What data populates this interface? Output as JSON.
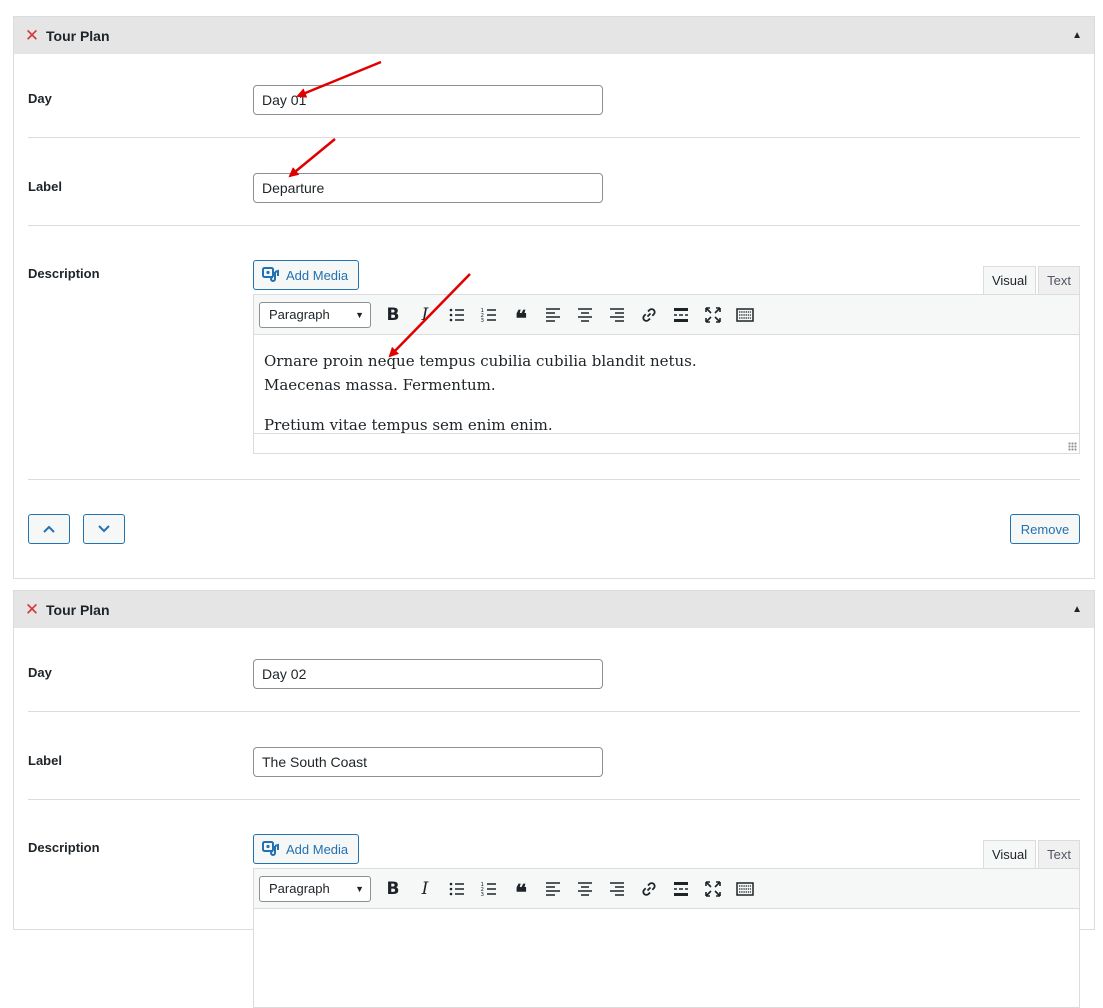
{
  "groups": [
    {
      "title": "Tour Plan",
      "day_label": "Day",
      "day_value": "Day 01",
      "label_label": "Label",
      "label_value": "Departure",
      "description_label": "Description",
      "add_media_label": "Add Media",
      "tabs": [
        "Visual",
        "Text"
      ],
      "format_value": "Paragraph",
      "content": [
        "Ornare proin neque tempus cubilia cubilia blandit netus.",
        "Maecenas massa. Fermentum.",
        "Pretium vitae tempus sem enim enim."
      ],
      "remove_label": "Remove"
    },
    {
      "title": "Tour Plan",
      "day_label": "Day",
      "day_value": "Day 02",
      "label_label": "Label",
      "label_value": "The South Coast",
      "description_label": "Description",
      "add_media_label": "Add Media",
      "tabs": [
        "Visual",
        "Text"
      ],
      "format_value": "Paragraph"
    }
  ],
  "colors": {
    "accent": "#2271b1",
    "remove": "#d63638",
    "annotation_arrow": "#e00000",
    "header_bg": "#e5e5e5"
  },
  "toolbar_icons": [
    "bold-icon",
    "italic-icon",
    "bullet-list-icon",
    "numbered-list-icon",
    "blockquote-icon",
    "align-left-icon",
    "align-center-icon",
    "align-right-icon",
    "link-icon",
    "read-more-icon",
    "fullscreen-icon",
    "toolbar-toggle-icon"
  ]
}
